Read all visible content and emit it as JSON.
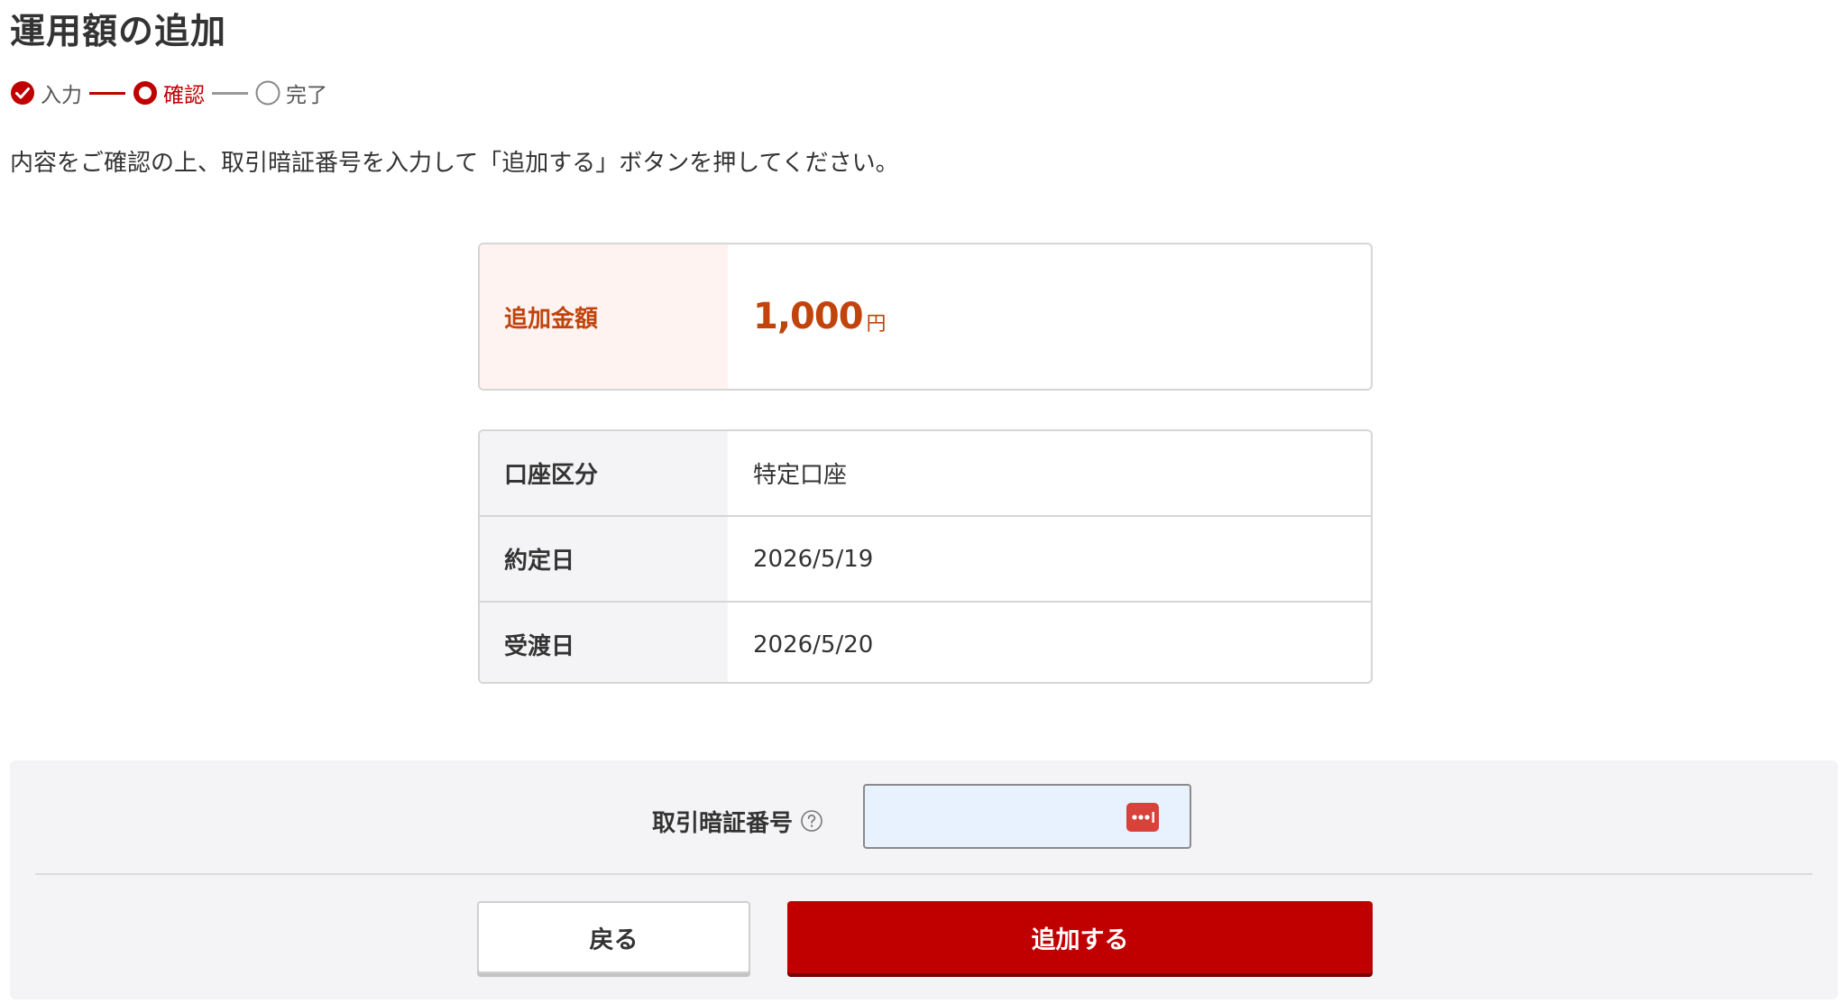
{
  "page": {
    "title": "運用額の追加"
  },
  "stepper": {
    "steps": [
      {
        "label": "入力",
        "state": "done"
      },
      {
        "label": "確認",
        "state": "current"
      },
      {
        "label": "完了",
        "state": "pending"
      }
    ]
  },
  "instruction": "内容をご確認の上、取引暗証番号を入力して「追加する」ボタンを押してください。",
  "amount": {
    "label": "追加金額",
    "value": "1,000",
    "unit": "円"
  },
  "details": [
    {
      "label": "口座区分",
      "value": "特定口座"
    },
    {
      "label": "約定日",
      "value": "2026/5/19"
    },
    {
      "label": "受渡日",
      "value": "2026/5/20"
    }
  ],
  "pin": {
    "label": "取引暗証番号",
    "value": "",
    "placeholder": ""
  },
  "buttons": {
    "back_label": "戻る",
    "submit_label": "追加する"
  },
  "icons": {
    "step_done": "check-circle-icon",
    "step_current": "ring-icon",
    "step_pending": "empty-circle-icon",
    "help": "question-circle-icon",
    "password_key": "password-key-icon"
  },
  "colors": {
    "accent": "#c00000",
    "amount_text": "#c0440c",
    "amount_label_bg": "#fff3f1",
    "label_bg": "#f4f4f6",
    "input_bg": "#e8f1fe",
    "panel_bg": "#f4f4f6"
  }
}
